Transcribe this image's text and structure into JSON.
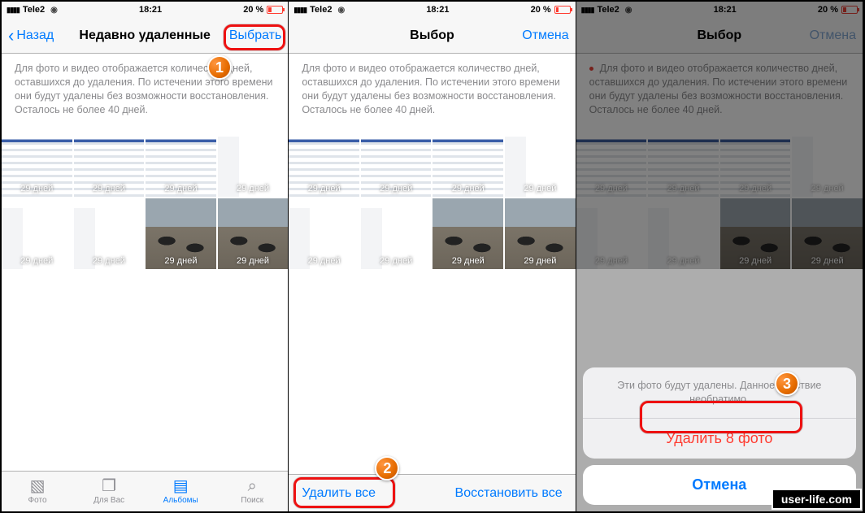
{
  "status": {
    "carrier": "Tele2",
    "time": "18:21",
    "battery": "20 %"
  },
  "screen1": {
    "back": "Назад",
    "title": "Недавно удаленные",
    "select": "Выбрать",
    "info": "Для фото и видео отображается количество дней, оставшихся до удаления. По истечении этого времени они будут удалены без возможности восстановления. Осталось не более 40 дней.",
    "days": [
      "29 дней",
      "29 дней",
      "29 дней",
      "29 дней",
      "29 дней",
      "29 дней",
      "29 дней",
      "29 дней"
    ],
    "tabs": {
      "photo": "Фото",
      "foryou": "Для Вас",
      "albums": "Альбомы",
      "search": "Поиск"
    }
  },
  "screen2": {
    "title": "Выбор",
    "cancel": "Отмена",
    "info": "Для фото и видео отображается количество дней, оставшихся до удаления. По истечении этого времени они будут удалены без возможности восстановления. Осталось не более 40 дней.",
    "days": [
      "29 дней",
      "29 дней",
      "29 дней",
      "29 дней",
      "29 дней",
      "29 дней",
      "29 дней",
      "29 дней"
    ],
    "delete_all": "Удалить все",
    "recover_all": "Восстановить все"
  },
  "screen3": {
    "title": "Выбор",
    "cancel": "Отмена",
    "info": "Для фото и видео отображается количество дней, оставшихся до удаления. По истечении этого времени они будут удалены без возможности восстановления. Осталось не более 40 дней.",
    "days": [
      "29 дней",
      "29 дней",
      "29 дней",
      "29 дней",
      "29 дней",
      "29 дней",
      "29 дней",
      "29 дней"
    ],
    "sheet_msg": "Эти фото будут удалены. Данное действие необратимо.",
    "sheet_delete": "Удалить 8 фото",
    "sheet_cancel": "Отмена"
  },
  "badges": {
    "one": "1",
    "two": "2",
    "three": "3"
  },
  "watermark": "user-life.com"
}
